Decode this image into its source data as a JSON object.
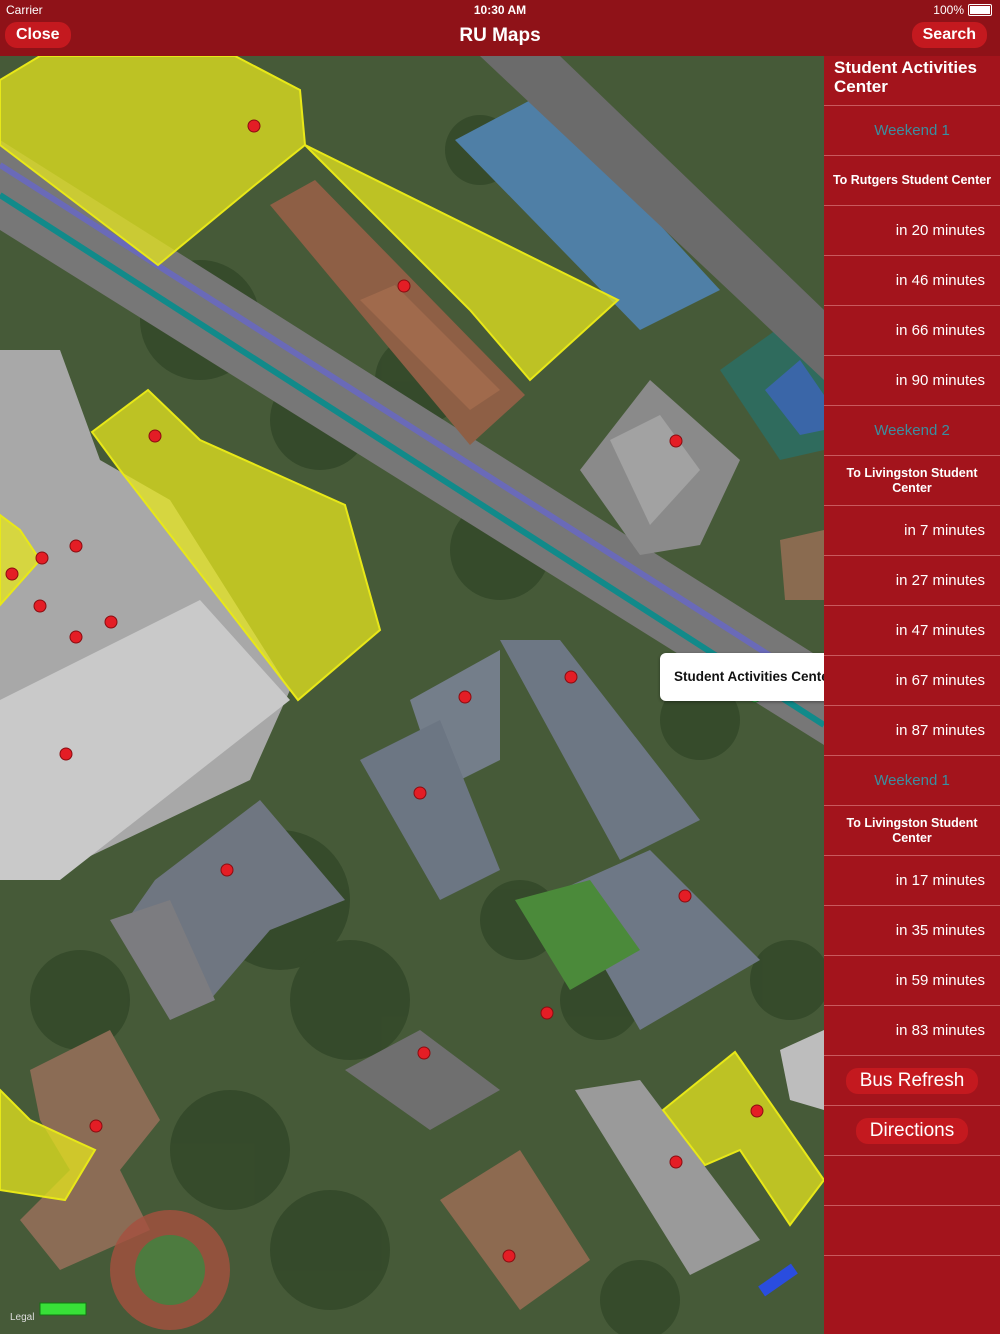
{
  "status_bar": {
    "carrier": "Carrier",
    "time": "10:30 AM",
    "battery": "100%"
  },
  "nav": {
    "title": "RU Maps",
    "close_label": "Close",
    "search_label": "Search"
  },
  "map": {
    "callout_text": "Student Activities Center",
    "legal_label": "Legal"
  },
  "panel": {
    "title": "Student Activities Center",
    "groups": [
      {
        "route": "Weekend 1",
        "destination": "To Rutgers Student Center",
        "times": [
          "in 20 minutes",
          "in 46 minutes",
          "in 66 minutes",
          "in 90 minutes"
        ]
      },
      {
        "route": "Weekend 2",
        "destination": "To Livingston Student Center",
        "times": [
          "in 7 minutes",
          "in 27 minutes",
          "in 47 minutes",
          "in 67 minutes",
          "in 87 minutes"
        ]
      },
      {
        "route": "Weekend 1",
        "destination": "To Livingston Student Center",
        "times": [
          "in 17 minutes",
          "in 35 minutes",
          "in 59 minutes",
          "in 83 minutes"
        ]
      }
    ],
    "bus_refresh_label": "Bus Refresh",
    "directions_label": "Directions"
  },
  "colors": {
    "brand": "#8f1218",
    "button": "#c4191f",
    "route_text": "#3a8fa0",
    "zone": "#e6e61e"
  }
}
